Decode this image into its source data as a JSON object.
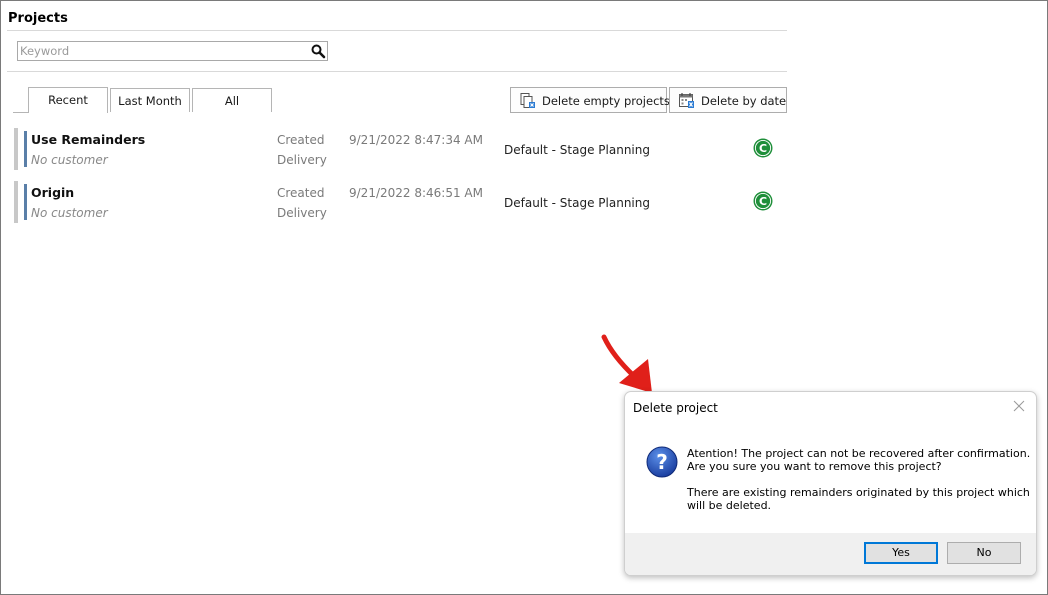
{
  "page": {
    "title": "Projects"
  },
  "search": {
    "placeholder": "Keyword",
    "value": "",
    "icon": "search-icon"
  },
  "tabs": [
    {
      "label": "Recent",
      "active": true
    },
    {
      "label": "Last Month",
      "active": false
    },
    {
      "label": "All",
      "active": false
    }
  ],
  "toolbar": {
    "delete_empty_label": "Delete empty projects",
    "delete_empty_icon": "delete-empty-projects-icon",
    "delete_by_date_label": "Delete by date",
    "delete_by_date_icon": "calendar-delete-icon"
  },
  "projects": [
    {
      "name": "Use Remainders",
      "customer": "No customer",
      "created_label": "Created",
      "delivery_label": "Delivery",
      "created": "9/21/2022 8:47:34 AM",
      "template": "Default - Stage Planning",
      "status_letter": "C",
      "status_color": "#1f8f3a"
    },
    {
      "name": "Origin",
      "customer": "No customer",
      "created_label": "Created",
      "delivery_label": "Delivery",
      "created": "9/21/2022 8:46:51 AM",
      "template": "Default - Stage Planning",
      "status_letter": "C",
      "status_color": "#1f8f3a"
    }
  ],
  "dialog": {
    "title": "Delete project",
    "line1": "Atention! The project can not be recovered after confirmation.",
    "line2": "Are you sure you want to remove this project?",
    "line3": "There are existing remainders originated by this project which",
    "line4": "will be deleted.",
    "yes_label": "Yes",
    "no_label": "No",
    "icon": "question-icon"
  },
  "colors": {
    "accent_strip": "#5a7fa8",
    "annotation_arrow": "#e0201a",
    "dialog_default_border": "#0078d7"
  }
}
